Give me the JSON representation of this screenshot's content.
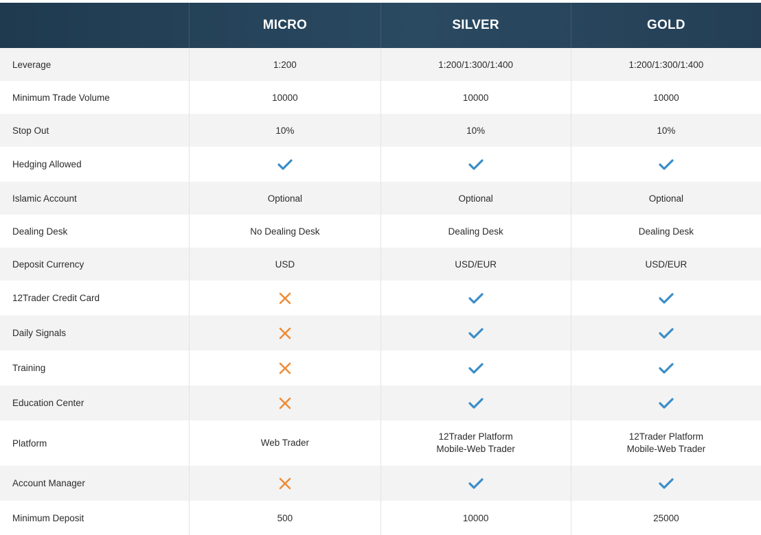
{
  "colors": {
    "check": "#3a8dc8",
    "cross": "#ef8b34",
    "header_bg": "#233f55"
  },
  "header": {
    "blank": "",
    "plans": [
      "MICRO",
      "SILVER",
      "GOLD"
    ]
  },
  "rows": [
    {
      "label": "Leverage",
      "values": [
        "1:200",
        "1:200/1:300/1:400",
        "1:200/1:300/1:400"
      ]
    },
    {
      "label": "Minimum Trade Volume",
      "values": [
        "10000",
        "10000",
        "10000"
      ]
    },
    {
      "label": "Stop Out",
      "values": [
        "10%",
        "10%",
        "10%"
      ]
    },
    {
      "label": "Hedging Allowed",
      "values": [
        "check-icon",
        "check-icon",
        "check-icon"
      ]
    },
    {
      "label": "Islamic Account",
      "values": [
        "Optional",
        "Optional",
        "Optional"
      ]
    },
    {
      "label": "Dealing Desk",
      "values": [
        "No Dealing Desk",
        "Dealing Desk",
        "Dealing Desk"
      ]
    },
    {
      "label": "Deposit Currency",
      "values": [
        "USD",
        "USD/EUR",
        "USD/EUR"
      ]
    },
    {
      "label": "12Trader Credit Card",
      "values": [
        "cross-icon",
        "check-icon",
        "check-icon"
      ]
    },
    {
      "label": "Daily Signals",
      "values": [
        "cross-icon",
        "check-icon",
        "check-icon"
      ]
    },
    {
      "label": "Training",
      "values": [
        "cross-icon",
        "check-icon",
        "check-icon"
      ]
    },
    {
      "label": "Education Center",
      "values": [
        "cross-icon",
        "check-icon",
        "check-icon"
      ]
    },
    {
      "label": "Platform",
      "values": [
        [
          "Web Trader"
        ],
        [
          "12Trader Platform",
          "Mobile-Web Trader"
        ],
        [
          "12Trader Platform",
          "Mobile-Web Trader"
        ]
      ]
    },
    {
      "label": "Account Manager",
      "values": [
        "cross-icon",
        "check-icon",
        "check-icon"
      ]
    },
    {
      "label": "Minimum Deposit",
      "values": [
        "500",
        "10000",
        "25000"
      ]
    }
  ]
}
